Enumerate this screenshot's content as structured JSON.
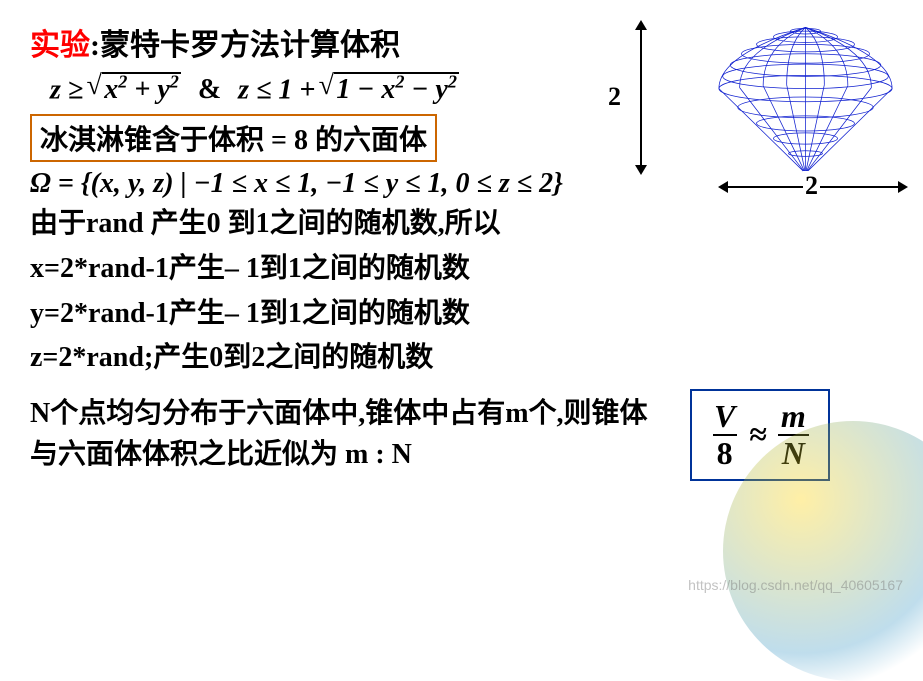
{
  "title": {
    "prefix": "实验",
    "colon": ":",
    "main": "蒙特卡罗方法计算体积"
  },
  "formula": {
    "lhs": "z ≥ ",
    "sqrt1": "x² + y²",
    "amp": "&",
    "rhs": "z ≤ 1 + ",
    "sqrt2": "1 − x² − y²"
  },
  "boxline": "冰淇淋锥含于体积 = 8 的六面体",
  "omega": "Ω = {(x, y, z) | −1 ≤ x ≤ 1, −1 ≤ y ≤ 1, 0 ≤ z ≤ 2}",
  "para1": "由于rand 产生0 到1之间的随机数,所以",
  "para2": "x=2*rand-1产生– 1到1之间的随机数",
  "para3": "y=2*rand-1产生– 1到1之间的随机数",
  "para4": "z=2*rand;产生0到2之间的随机数",
  "bottom_text": "N个点均匀分布于六面体中,锥体中占有m个,则锥体与六面体体积之比近似为 m : N",
  "ratio": {
    "Vnum": "V",
    "Vden": "8",
    "approx": "≈",
    "Mnum": "m",
    "Mden": "N"
  },
  "dims": {
    "height": "2",
    "width": "2"
  },
  "watermark": "https://blog.csdn.net/qq_40605167"
}
